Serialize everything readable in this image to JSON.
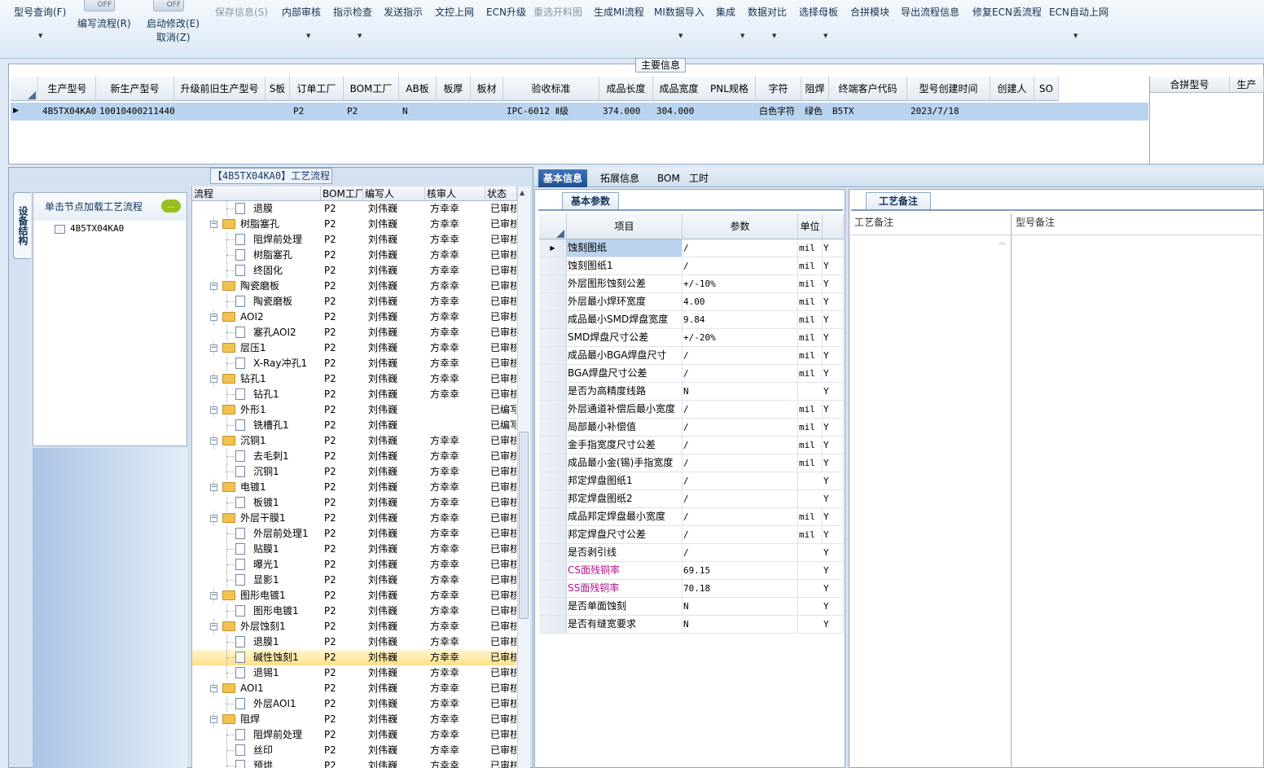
{
  "toolbar": {
    "items": [
      {
        "label": "型号查询(F)",
        "dropdown": true,
        "enabled": true
      },
      {
        "label": "编写流程(R)",
        "enabled": true,
        "toggle": "OFF"
      },
      {
        "label": "启动修改(E)",
        "sublabel": "取消(Z)",
        "enabled": true,
        "toggle": "OFF"
      },
      {
        "label": "保存信息(S)",
        "enabled": false
      },
      {
        "label": "内部审核",
        "dropdown": true,
        "enabled": true
      },
      {
        "label": "指示检查",
        "dropdown": true,
        "enabled": true
      },
      {
        "label": "发送指示",
        "enabled": true
      },
      {
        "label": "文控上网",
        "enabled": true
      },
      {
        "label": "ECN升级",
        "enabled": true
      },
      {
        "label": "重选开料图",
        "enabled": false
      },
      {
        "label": "生成MI流程",
        "enabled": true
      },
      {
        "label": "MI数据导入",
        "dropdown": true,
        "enabled": true
      },
      {
        "label": "集成",
        "dropdown": true,
        "enabled": true
      },
      {
        "label": "数据对比",
        "dropdown": true,
        "enabled": true
      },
      {
        "label": "选择母板",
        "dropdown": true,
        "enabled": true
      },
      {
        "label": "合拼模块",
        "enabled": true
      },
      {
        "label": "导出流程信息",
        "enabled": true
      },
      {
        "label": "修复ECN丢流程",
        "enabled": true
      },
      {
        "label": "ECN自动上网",
        "dropdown": true,
        "enabled": true
      }
    ]
  },
  "main_info": {
    "title": "主要信息",
    "columns": [
      "生产型号",
      "新生产型号",
      "升级前旧生产型号",
      "S板",
      "订单工厂",
      "BOM工厂",
      "AB板",
      "板厚",
      "板材",
      "验收标准",
      "成品长度",
      "成品宽度",
      "PNL规格",
      "字符",
      "阻焊",
      "终端客户代码",
      "型号创建时间",
      "创建人",
      "SO"
    ],
    "row": {
      "生产型号": "4B5TX04KA0",
      "新生产型号": "10010400211440",
      "升级前旧生产型号": "",
      "S板": "",
      "订单工厂": "P2",
      "BOM工厂": "P2",
      "AB板": "N",
      "板厚": "",
      "板材": "",
      "验收标准": "IPC-6012 Ⅱ级",
      "成品长度": "374.000",
      "成品宽度": "304.000",
      "PNL规格": "",
      "字符": "白色字符",
      "阻焊": "绿色",
      "终端客户代码": "B5TX",
      "型号创建时间": "2023/7/18",
      "创建人": "",
      "SO": ""
    },
    "side_columns": [
      "合拼型号",
      "生产"
    ]
  },
  "left": {
    "vertical_tab": "设备结构",
    "node_header": "单击节点加载工艺流程",
    "root_node": "4B5TX04KA0",
    "flow_title": "【4B5TX04KA0】工艺流程",
    "flow_columns": [
      "流程",
      "BOM工厂",
      "编写人",
      "核审人",
      "状态"
    ],
    "flow_rows": [
      {
        "level": 2,
        "name": "退膜",
        "bom": "P2",
        "writer": "刘伟巍",
        "reviewer": "方幸幸",
        "status": "已审核"
      },
      {
        "level": 1,
        "name": "树脂塞孔",
        "bom": "P2",
        "writer": "刘伟巍",
        "reviewer": "方幸幸",
        "status": "已审核"
      },
      {
        "level": 2,
        "name": "阻焊前处理",
        "bom": "P2",
        "writer": "刘伟巍",
        "reviewer": "方幸幸",
        "status": "已审核"
      },
      {
        "level": 2,
        "name": "树脂塞孔",
        "bom": "P2",
        "writer": "刘伟巍",
        "reviewer": "方幸幸",
        "status": "已审核"
      },
      {
        "level": 2,
        "name": "终固化",
        "bom": "P2",
        "writer": "刘伟巍",
        "reviewer": "方幸幸",
        "status": "已审核"
      },
      {
        "level": 1,
        "name": "陶瓷磨板",
        "bom": "P2",
        "writer": "刘伟巍",
        "reviewer": "方幸幸",
        "status": "已审核"
      },
      {
        "level": 2,
        "name": "陶瓷磨板",
        "bom": "P2",
        "writer": "刘伟巍",
        "reviewer": "方幸幸",
        "status": "已审核"
      },
      {
        "level": 1,
        "name": "AOI2",
        "bom": "P2",
        "writer": "刘伟巍",
        "reviewer": "方幸幸",
        "status": "已审核"
      },
      {
        "level": 2,
        "name": "塞孔AOI2",
        "bom": "P2",
        "writer": "刘伟巍",
        "reviewer": "方幸幸",
        "status": "已审核"
      },
      {
        "level": 1,
        "name": "层压1",
        "bom": "P2",
        "writer": "刘伟巍",
        "reviewer": "方幸幸",
        "status": "已审核"
      },
      {
        "level": 2,
        "name": "X-Ray冲孔1",
        "bom": "P2",
        "writer": "刘伟巍",
        "reviewer": "方幸幸",
        "status": "已审核"
      },
      {
        "level": 1,
        "name": "钻孔1",
        "bom": "P2",
        "writer": "刘伟巍",
        "reviewer": "方幸幸",
        "status": "已审核"
      },
      {
        "level": 2,
        "name": "钻孔1",
        "bom": "P2",
        "writer": "刘伟巍",
        "reviewer": "方幸幸",
        "status": "已审核"
      },
      {
        "level": 1,
        "name": "外形1",
        "bom": "P2",
        "writer": "刘伟巍",
        "reviewer": "",
        "status": "已编写"
      },
      {
        "level": 2,
        "name": "铣槽孔1",
        "bom": "P2",
        "writer": "刘伟巍",
        "reviewer": "",
        "status": "已编写"
      },
      {
        "level": 1,
        "name": "沉铜1",
        "bom": "P2",
        "writer": "刘伟巍",
        "reviewer": "方幸幸",
        "status": "已审核"
      },
      {
        "level": 2,
        "name": "去毛刺1",
        "bom": "P2",
        "writer": "刘伟巍",
        "reviewer": "方幸幸",
        "status": "已审核"
      },
      {
        "level": 2,
        "name": "沉铜1",
        "bom": "P2",
        "writer": "刘伟巍",
        "reviewer": "方幸幸",
        "status": "已审核"
      },
      {
        "level": 1,
        "name": "电镀1",
        "bom": "P2",
        "writer": "刘伟巍",
        "reviewer": "方幸幸",
        "status": "已审核"
      },
      {
        "level": 2,
        "name": "板镀1",
        "bom": "P2",
        "writer": "刘伟巍",
        "reviewer": "方幸幸",
        "status": "已审核"
      },
      {
        "level": 1,
        "name": "外层干膜1",
        "bom": "P2",
        "writer": "刘伟巍",
        "reviewer": "方幸幸",
        "status": "已审核"
      },
      {
        "level": 2,
        "name": "外层前处理1",
        "bom": "P2",
        "writer": "刘伟巍",
        "reviewer": "方幸幸",
        "status": "已审核"
      },
      {
        "level": 2,
        "name": "贴膜1",
        "bom": "P2",
        "writer": "刘伟巍",
        "reviewer": "方幸幸",
        "status": "已审核"
      },
      {
        "level": 2,
        "name": "曝光1",
        "bom": "P2",
        "writer": "刘伟巍",
        "reviewer": "方幸幸",
        "status": "已审核"
      },
      {
        "level": 2,
        "name": "显影1",
        "bom": "P2",
        "writer": "刘伟巍",
        "reviewer": "方幸幸",
        "status": "已审核"
      },
      {
        "level": 1,
        "name": "图形电镀1",
        "bom": "P2",
        "writer": "刘伟巍",
        "reviewer": "方幸幸",
        "status": "已审核"
      },
      {
        "level": 2,
        "name": "图形电镀1",
        "bom": "P2",
        "writer": "刘伟巍",
        "reviewer": "方幸幸",
        "status": "已审核"
      },
      {
        "level": 1,
        "name": "外层蚀刻1",
        "bom": "P2",
        "writer": "刘伟巍",
        "reviewer": "方幸幸",
        "status": "已审核"
      },
      {
        "level": 2,
        "name": "退膜1",
        "bom": "P2",
        "writer": "刘伟巍",
        "reviewer": "方幸幸",
        "status": "已审核"
      },
      {
        "level": 2,
        "name": "碱性蚀刻1",
        "bom": "P2",
        "writer": "刘伟巍",
        "reviewer": "方幸幸",
        "status": "已审核",
        "selected": true
      },
      {
        "level": 2,
        "name": "退锡1",
        "bom": "P2",
        "writer": "刘伟巍",
        "reviewer": "方幸幸",
        "status": "已审核"
      },
      {
        "level": 1,
        "name": "AOI1",
        "bom": "P2",
        "writer": "刘伟巍",
        "reviewer": "方幸幸",
        "status": "已审核"
      },
      {
        "level": 2,
        "name": "外层AOI1",
        "bom": "P2",
        "writer": "刘伟巍",
        "reviewer": "方幸幸",
        "status": "已审核"
      },
      {
        "level": 1,
        "name": "阻焊",
        "bom": "P2",
        "writer": "刘伟巍",
        "reviewer": "方幸幸",
        "status": "已审核"
      },
      {
        "level": 2,
        "name": "阻焊前处理",
        "bom": "P2",
        "writer": "刘伟巍",
        "reviewer": "方幸幸",
        "status": "已审核"
      },
      {
        "level": 2,
        "name": "丝印",
        "bom": "P2",
        "writer": "刘伟巍",
        "reviewer": "方幸幸",
        "status": "已审核"
      },
      {
        "level": 2,
        "name": "预烘",
        "bom": "P2",
        "writer": "刘伟巍",
        "reviewer": "方幸幸",
        "status": "已审核"
      }
    ]
  },
  "right_tabs": [
    "基本信息",
    "拓展信息",
    "BOM",
    "工时"
  ],
  "basic_params": {
    "tab": "基本参数",
    "columns": [
      "项目",
      "参数",
      "单位"
    ],
    "rows": [
      {
        "item": "蚀刻图纸",
        "param": "/",
        "unit": "mil",
        "flag": "Y",
        "current": true
      },
      {
        "item": "蚀刻图纸1",
        "param": "/",
        "unit": "mil",
        "flag": "Y"
      },
      {
        "item": "外层图形蚀刻公差",
        "param": "+/-10%",
        "unit": "mil",
        "flag": "Y"
      },
      {
        "item": "外层最小焊环宽度",
        "param": "4.00",
        "unit": "mil",
        "flag": "Y"
      },
      {
        "item": "成品最小SMD焊盘宽度",
        "param": "9.84",
        "unit": "mil",
        "flag": "Y"
      },
      {
        "item": "SMD焊盘尺寸公差",
        "param": "+/-20%",
        "unit": "mil",
        "flag": "Y"
      },
      {
        "item": "成品最小BGA焊盘尺寸",
        "param": "/",
        "unit": "mil",
        "flag": "Y"
      },
      {
        "item": "BGA焊盘尺寸公差",
        "param": "/",
        "unit": "mil",
        "flag": "Y"
      },
      {
        "item": "是否为高精度线路",
        "param": "N",
        "unit": "",
        "flag": "Y"
      },
      {
        "item": "外层通道补偿后最小宽度",
        "param": "/",
        "unit": "mil",
        "flag": "Y"
      },
      {
        "item": "局部最小补偿值",
        "param": "/",
        "unit": "mil",
        "flag": "Y"
      },
      {
        "item": "金手指宽度尺寸公差",
        "param": "/",
        "unit": "mil",
        "flag": "Y"
      },
      {
        "item": "成品最小金(锡)手指宽度",
        "param": "/",
        "unit": "mil",
        "flag": "Y"
      },
      {
        "item": "邦定焊盘图纸1",
        "param": "/",
        "unit": "",
        "flag": "Y"
      },
      {
        "item": "邦定焊盘图纸2",
        "param": "/",
        "unit": "",
        "flag": "Y"
      },
      {
        "item": "成品邦定焊盘最小宽度",
        "param": "/",
        "unit": "mil",
        "flag": "Y"
      },
      {
        "item": "邦定焊盘尺寸公差",
        "param": "/",
        "unit": "mil",
        "flag": "Y"
      },
      {
        "item": "是否剥引线",
        "param": "/",
        "unit": "",
        "flag": "Y"
      },
      {
        "item": "CS面残铜率",
        "param": "69.15",
        "unit": "",
        "flag": "Y",
        "highlight": true
      },
      {
        "item": "SS面残铜率",
        "param": "70.18",
        "unit": "",
        "flag": "Y",
        "highlight": true
      },
      {
        "item": "是否单面蚀刻",
        "param": "N",
        "unit": "",
        "flag": "Y"
      },
      {
        "item": "是否有缝宽要求",
        "param": "N",
        "unit": "",
        "flag": "Y"
      }
    ]
  },
  "notes": {
    "tab": "工艺备注",
    "columns": [
      "工艺备注",
      "型号备注"
    ]
  },
  "colors": {
    "highlight_text": "#b0148a",
    "selected_row": "#bad3ee",
    "accent": "#1e4f91"
  }
}
